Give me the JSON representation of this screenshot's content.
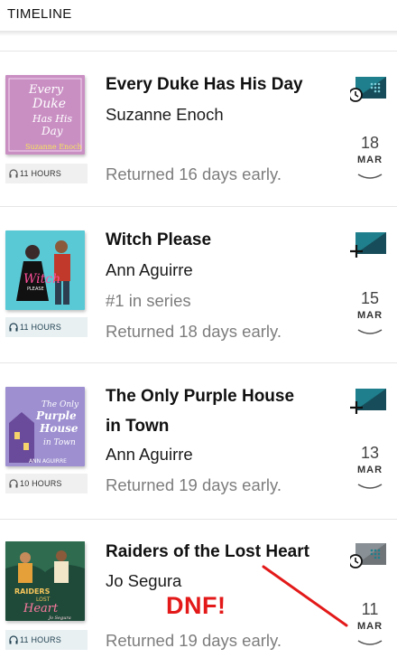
{
  "header": {
    "title": "TIMELINE"
  },
  "entries": [
    {
      "title": "Every Duke Has His Day",
      "author": "Suzanne Enoch",
      "status": "Returned 16 days early.",
      "duration": "11 HOURS",
      "day": "18",
      "month": "MAR",
      "badge_icon": "clock-badge-icon",
      "cover_text": [
        "Every",
        "Duke",
        "Has His",
        "Day",
        "Suzanne Enoch"
      ],
      "cover_color": "#c98fc3"
    },
    {
      "title": "Witch Please",
      "author": "Ann Aguirre",
      "series": "#1 in series",
      "status": "Returned 18 days early.",
      "duration": "11 HOURS",
      "day": "15",
      "month": "MAR",
      "badge_icon": "add-badge-icon",
      "cover_text": [
        "Witch",
        "PLEASE"
      ],
      "cover_color": "#5ac9d6"
    },
    {
      "title_line1": "The Only Purple House",
      "title_line2": "in Town",
      "author": "Ann Aguirre",
      "status": "Returned 19 days early.",
      "duration": "10 HOURS",
      "day": "13",
      "month": "MAR",
      "badge_icon": "add-badge-icon",
      "cover_text": [
        "The Only",
        "Purple",
        "House",
        "in Town",
        "ANN AGUIRRE"
      ],
      "cover_color": "#9d8fd0"
    },
    {
      "title": "Raiders of the Lost Heart",
      "author": "Jo Segura",
      "status": "Returned 19 days early.",
      "duration": "11 HOURS",
      "day": "11",
      "month": "MAR",
      "badge_icon": "clock-badge-icon",
      "cover_text": [
        "RAIDERS",
        "LOST",
        "Heart",
        "Jo Segura"
      ],
      "cover_color": "#1f4a3a"
    }
  ],
  "annotation": {
    "text": "DNF!",
    "color": "#e31919"
  },
  "colors": {
    "badge_dark": "#174d5a",
    "badge_teal": "#1f7f8c",
    "badge_gray": "#6f7478",
    "muted_text": "#7d7d7d"
  }
}
